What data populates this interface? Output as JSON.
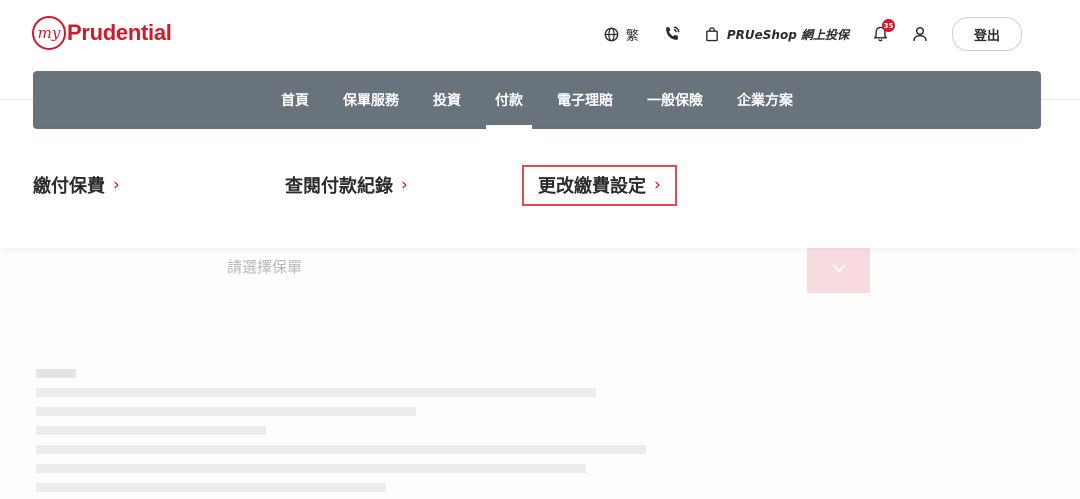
{
  "header": {
    "logo_my": "my",
    "logo_text": "Prudential",
    "language_label": "繁",
    "shop_label": "PRUeShop 網上投保",
    "notification_count": "35",
    "logout_label": "登出"
  },
  "nav": {
    "items": [
      {
        "label": "首頁"
      },
      {
        "label": "保單服務"
      },
      {
        "label": "投資"
      },
      {
        "label": "付款"
      },
      {
        "label": "電子理賠"
      },
      {
        "label": "一般保險"
      },
      {
        "label": "企業方案"
      }
    ],
    "active": "付款"
  },
  "dropdown": {
    "items": [
      {
        "label": "繳付保費",
        "chevron": "›"
      },
      {
        "label": "查閱付款紀錄",
        "chevron": "›"
      },
      {
        "label": "更改繳費設定",
        "chevron": "›"
      }
    ],
    "highlighted": "更改繳費設定"
  },
  "background": {
    "select_placeholder": "請選擇保單"
  },
  "colors": {
    "brand_red": "#d3192b",
    "nav_bg": "#69737b",
    "highlight_border": "#e34a52"
  }
}
